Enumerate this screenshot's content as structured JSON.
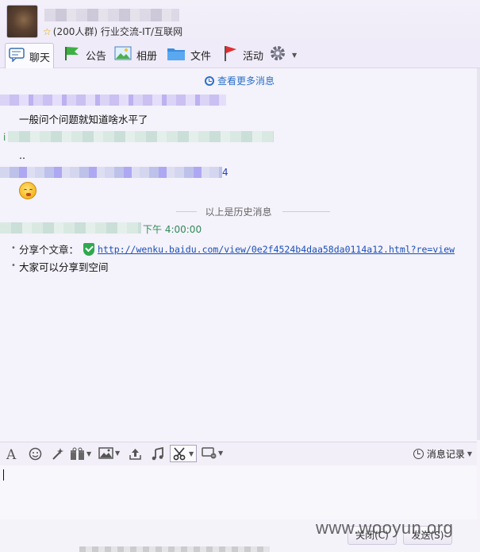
{
  "header": {
    "group_meta": "(200人群) 行业交流-IT/互联网"
  },
  "toolbar": {
    "tabs": [
      {
        "label": "聊天",
        "icon": "chat-bubble-icon"
      },
      {
        "label": "公告",
        "icon": "flag-icon"
      },
      {
        "label": "相册",
        "icon": "photo-album-icon"
      },
      {
        "label": "文件",
        "icon": "folder-icon"
      },
      {
        "label": "活动",
        "icon": "red-flag-icon"
      },
      {
        "label": "",
        "icon": "gear-icon"
      }
    ]
  },
  "chat": {
    "view_more": "查看更多消息",
    "messages": [
      {
        "text": "一般问个问题就知道啥水平了"
      },
      {
        "sender_fragment": "i"
      },
      {
        "text": ".."
      },
      {
        "sender_fragment": "4"
      },
      {
        "emoji": "smiley-emoji"
      }
    ],
    "history_divider": "以上是历史消息",
    "time_fragment": "下午 4:00:00",
    "latest": {
      "line1_prefix": "分享个文章：",
      "link": "http://wenku.baidu.com/view/0e2f4524b4daa58da0114a12.html?re=view",
      "line2": "大家可以分享到空间"
    }
  },
  "input_toolbar": {
    "icons": [
      "font-icon",
      "emoji-icon",
      "magic-wand-icon",
      "gift-icon",
      "image-icon",
      "upload-icon",
      "music-icon",
      "scissors-icon",
      "screen-share-icon"
    ],
    "history_label": "消息记录"
  },
  "bottom": {
    "close_label": "关闭(C)",
    "send_label": "发送(S)"
  },
  "watermark": "www.wooyun.org"
}
